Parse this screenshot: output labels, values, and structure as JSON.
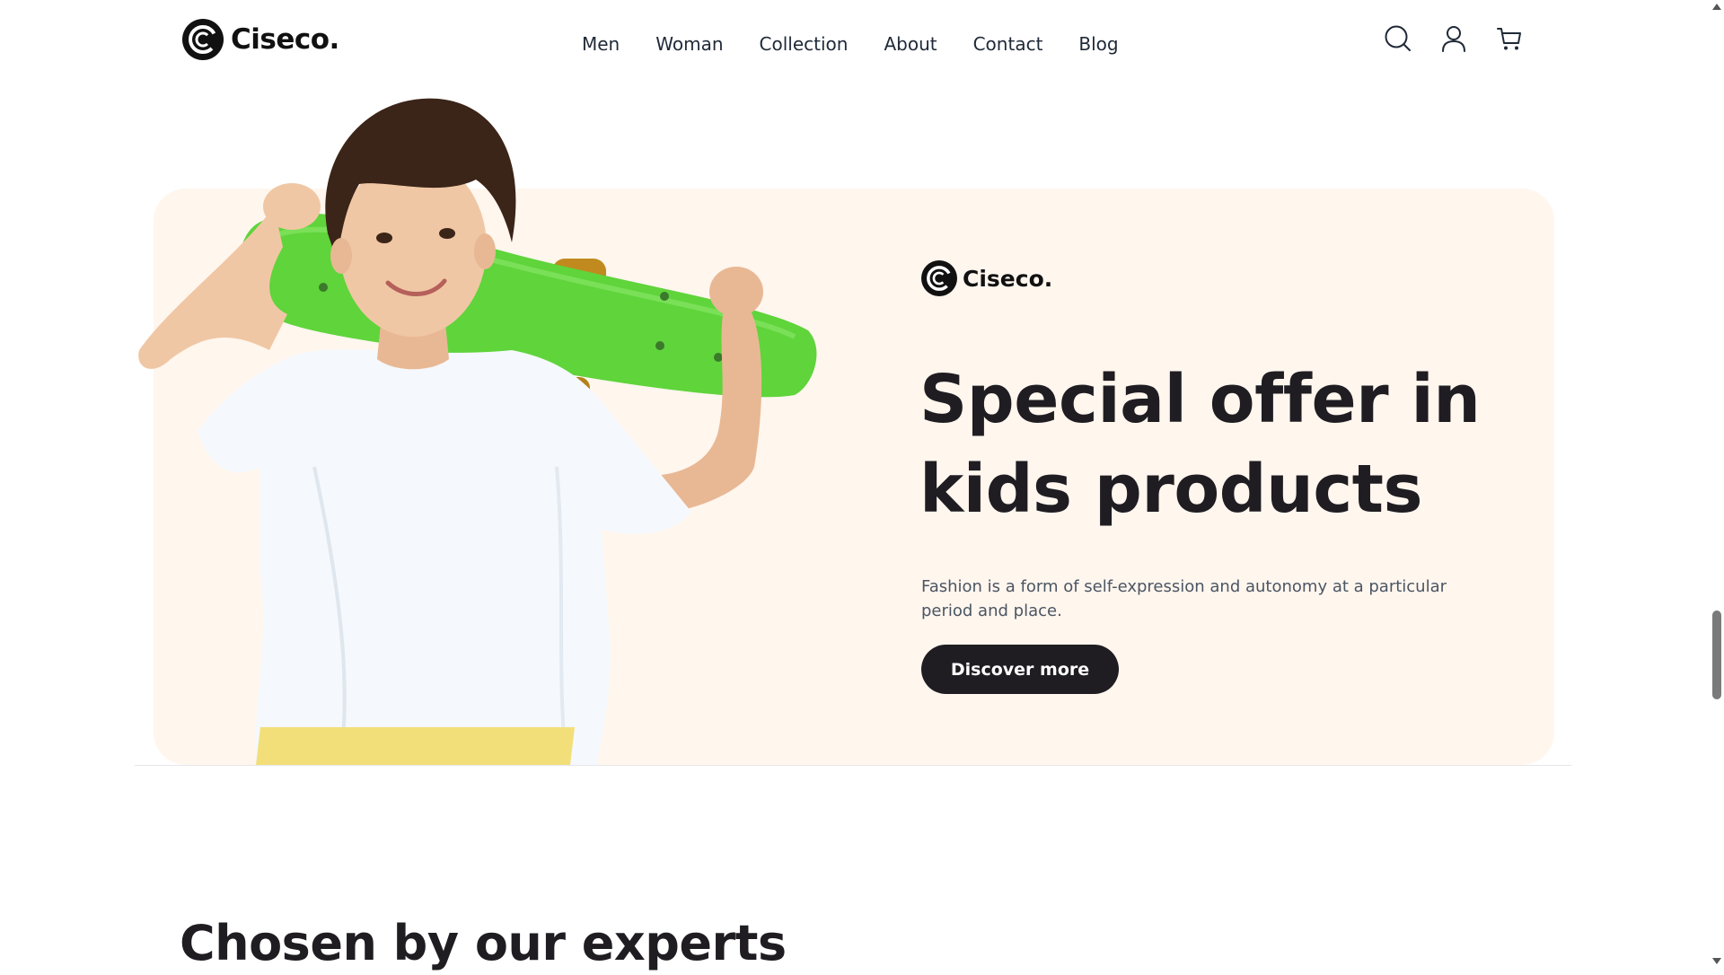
{
  "header": {
    "logo_text": "Ciseco.",
    "nav": [
      "Men",
      "Woman",
      "Collection",
      "About",
      "Contact",
      "Blog"
    ],
    "icons": [
      "search-icon",
      "user-icon",
      "cart-icon"
    ]
  },
  "banner": {
    "logo_text": "Ciseco.",
    "title": "Special offer in kids products",
    "description": "Fashion is a form of self-expression and autonomy at a particular period and place.",
    "button_label": "Discover more",
    "background_color": "#fff6ee",
    "image": "kid-with-green-skateboard"
  },
  "section": {
    "title": "Chosen by our experts"
  },
  "colors": {
    "dark": "#1f1d22",
    "text": "#1f2937",
    "muted": "#4b5563"
  }
}
